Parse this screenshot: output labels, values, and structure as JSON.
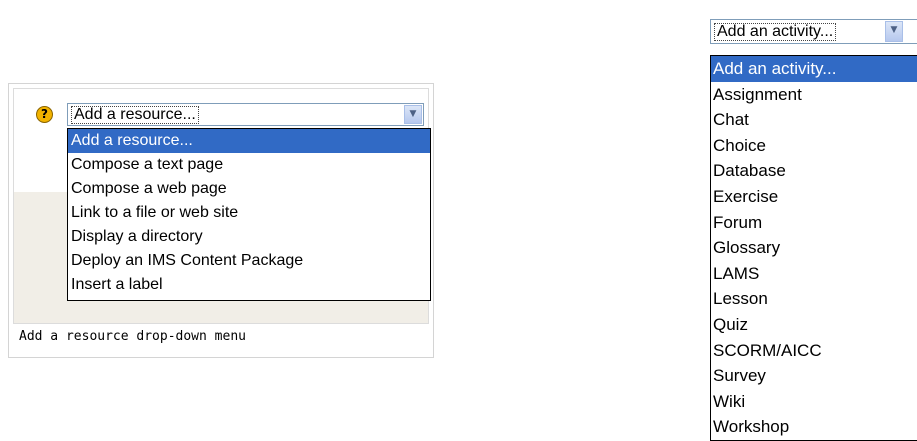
{
  "resource_widget": {
    "selected_label": "Add a resource...",
    "options": [
      "Add a resource...",
      "Compose a text page",
      "Compose a web page",
      "Link to a file or web site",
      "Display a directory",
      "Deploy an IMS Content Package",
      "Insert a label"
    ],
    "highlighted_index": 0,
    "help_icon_glyph": "?",
    "caption": "Add a resource drop-down menu"
  },
  "activity_widget": {
    "selected_label": "Add an activity...",
    "options": [
      "Add an activity...",
      "Assignment",
      "Chat",
      "Choice",
      "Database",
      "Exercise",
      "Forum",
      "Glossary",
      "LAMS",
      "Lesson",
      "Quiz",
      "SCORM/AICC",
      "Survey",
      "Wiki",
      "Workshop"
    ],
    "highlighted_index": 0
  },
  "icons": {
    "help": "help-icon",
    "dropdown": "chevron-down-icon"
  },
  "colors": {
    "selection": "#316ac5",
    "panel_bg": "#f1eee7",
    "help_icon": "#f2b300"
  }
}
